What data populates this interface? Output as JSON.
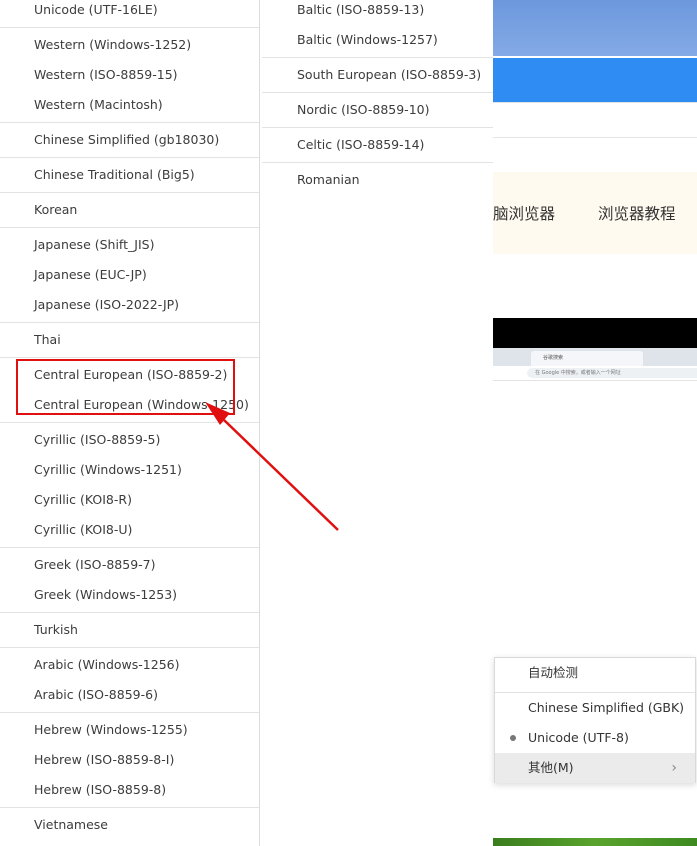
{
  "encoding_menu_left": {
    "items": [
      {
        "label": "Unicode (UTF-16LE)"
      },
      {
        "label": "Western (Windows-1252)"
      },
      {
        "label": "Western (ISO-8859-15)"
      },
      {
        "label": "Western (Macintosh)"
      },
      {
        "label": "Chinese Simplified (gb18030)"
      },
      {
        "label": "Chinese Traditional (Big5)"
      },
      {
        "label": "Korean"
      },
      {
        "label": "Japanese (Shift_JIS)"
      },
      {
        "label": "Japanese (EUC-JP)"
      },
      {
        "label": "Japanese (ISO-2022-JP)"
      },
      {
        "label": "Thai"
      },
      {
        "label": "Central European (ISO-8859-2)"
      },
      {
        "label": "Central European (Windows-1250)"
      },
      {
        "label": "Cyrillic (ISO-8859-5)"
      },
      {
        "label": "Cyrillic (Windows-1251)"
      },
      {
        "label": "Cyrillic (KOI8-R)"
      },
      {
        "label": "Cyrillic (KOI8-U)"
      },
      {
        "label": "Greek (ISO-8859-7)"
      },
      {
        "label": "Greek (Windows-1253)"
      },
      {
        "label": "Turkish"
      },
      {
        "label": "Arabic (Windows-1256)"
      },
      {
        "label": "Arabic (ISO-8859-6)"
      },
      {
        "label": "Hebrew (Windows-1255)"
      },
      {
        "label": "Hebrew (ISO-8859-8-I)"
      },
      {
        "label": "Hebrew (ISO-8859-8)"
      },
      {
        "label": "Vietnamese"
      }
    ]
  },
  "encoding_menu_right": {
    "items": [
      {
        "label": "Baltic (ISO-8859-13)"
      },
      {
        "label": "Baltic (Windows-1257)"
      },
      {
        "label": "South European (ISO-8859-3)"
      },
      {
        "label": "Nordic (ISO-8859-10)"
      },
      {
        "label": "Celtic (ISO-8859-14)"
      },
      {
        "label": "Romanian"
      }
    ]
  },
  "background_page": {
    "nav_item_1": "脑浏览器",
    "nav_item_2": "浏览器教程",
    "screenshot_tab": "谷歌搜索",
    "screenshot_address": "在 Google 中搜索，或者输入一个网址"
  },
  "encoding_popup": {
    "auto_detect": "自动检测",
    "chinese_gbk": "Chinese Simplified (GBK)",
    "unicode_utf8": "Unicode (UTF-8)",
    "other": "其他(M)"
  },
  "colors": {
    "highlight": "#e01010",
    "page_blue": "#2f8cf3"
  }
}
